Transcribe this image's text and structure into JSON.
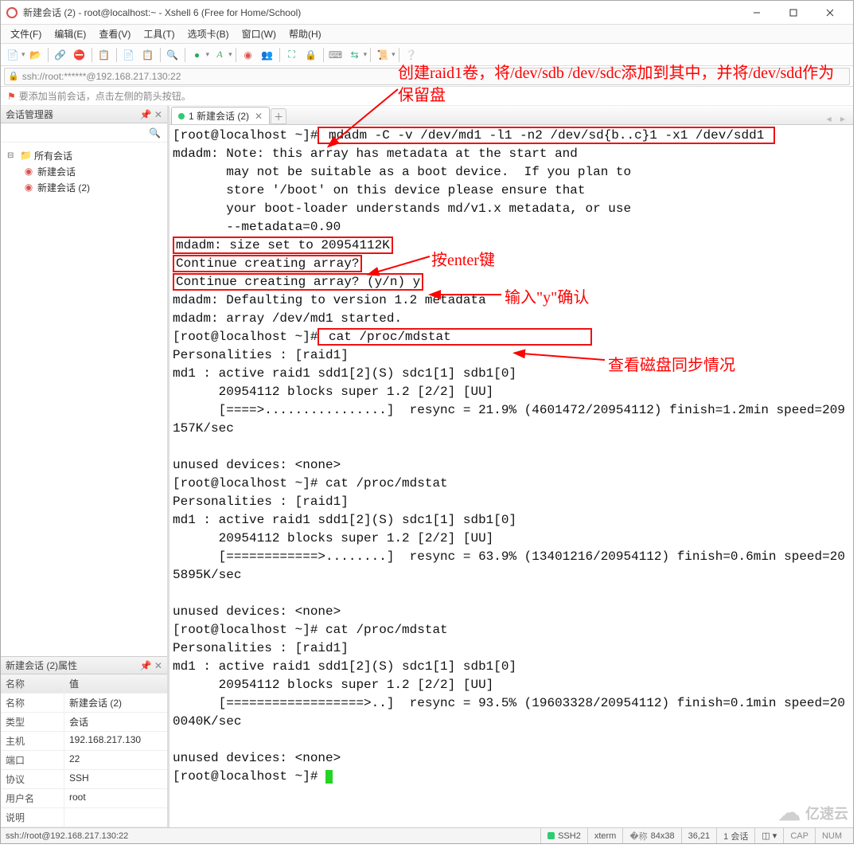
{
  "window": {
    "title": "新建会话 (2) - root@localhost:~ - Xshell 6 (Free for Home/School)"
  },
  "menu": [
    "文件(F)",
    "编辑(E)",
    "查看(V)",
    "工具(T)",
    "选项卡(B)",
    "窗口(W)",
    "帮助(H)"
  ],
  "address": "ssh://root:******@192.168.217.130:22",
  "hint": "要添加当前会话，点击左侧的箭头按钮。",
  "leftpanel": {
    "title": "会话管理器",
    "tree_root": "所有会话",
    "tree_items": [
      "新建会话",
      "新建会话 (2)"
    ]
  },
  "props": {
    "title": "新建会话 (2)属性",
    "hdr_name": "名称",
    "hdr_value": "值",
    "rows": [
      {
        "k": "名称",
        "v": "新建会话 (2)"
      },
      {
        "k": "类型",
        "v": "会话"
      },
      {
        "k": "主机",
        "v": "192.168.217.130"
      },
      {
        "k": "端口",
        "v": "22"
      },
      {
        "k": "协议",
        "v": "SSH"
      },
      {
        "k": "用户名",
        "v": "root"
      },
      {
        "k": "说明",
        "v": ""
      }
    ]
  },
  "tabs": {
    "active": "1 新建会话 (2)"
  },
  "terminal": {
    "prompt1": "[root@localhost ~]#",
    "cmd1": " mdadm -C -v /dev/md1 -l1 -n2 /dev/sd{b..c}1 -x1 /dev/sdd1 ",
    "out1": "mdadm: Note: this array has metadata at the start and\n       may not be suitable as a boot device.  If you plan to\n       store '/boot' on this device please ensure that\n       your boot-loader understands md/v1.x metadata, or use\n       --metadata=0.90",
    "out2": "mdadm: size set to 20954112K",
    "out3": "Continue creating array?",
    "out4": "Continue creating array? (y/n) y",
    "out5": "mdadm: Defaulting to version 1.2 metadata\nmdadm: array /dev/md1 started.",
    "prompt2_pre": "[root@localhost ~]#",
    "cmd2": " cat /proc/mdstat                  ",
    "out6": "Personalities : [raid1]\nmd1 : active raid1 sdd1[2](S) sdc1[1] sdb1[0]\n      20954112 blocks super 1.2 [2/2] [UU]\n      [====>................]  resync = 21.9% (4601472/20954112) finish=1.2min speed=209157K/sec\n\nunused devices: <none>\n[root@localhost ~]# cat /proc/mdstat\nPersonalities : [raid1]\nmd1 : active raid1 sdd1[2](S) sdc1[1] sdb1[0]\n      20954112 blocks super 1.2 [2/2] [UU]\n      [============>........]  resync = 63.9% (13401216/20954112) finish=0.6min speed=205895K/sec\n\nunused devices: <none>\n[root@localhost ~]# cat /proc/mdstat\nPersonalities : [raid1]\nmd1 : active raid1 sdd1[2](S) sdc1[1] sdb1[0]\n      20954112 blocks super 1.2 [2/2] [UU]\n      [==================>..]  resync = 93.5% (19603328/20954112) finish=0.1min speed=200040K/sec\n\nunused devices: <none>\n[root@localhost ~]# "
  },
  "annotations": {
    "a1": "创建raid1卷，将/dev/sdb /dev/sdc添加到其中，并将/dev/sdd作为保留盘",
    "a2": "按enter键",
    "a3": "输入\"y\"确认",
    "a4": "查看磁盘同步情况"
  },
  "status": {
    "left": "ssh://root@192.168.217.130:22",
    "ssh": "SSH2",
    "term": "xterm",
    "size": "84x38",
    "pos": "36,21",
    "sess": "1 会话",
    "cap": "CAP",
    "num": "NUM"
  },
  "watermark": "亿速云"
}
